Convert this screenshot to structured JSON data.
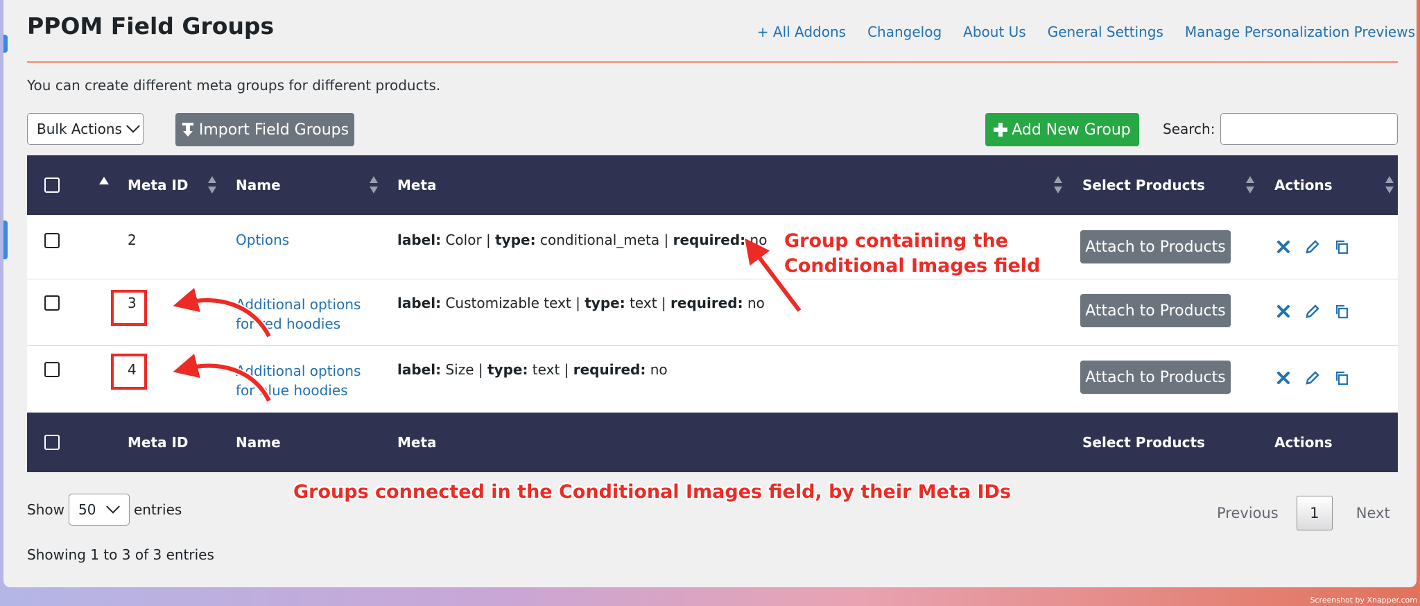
{
  "page": {
    "title": "PPOM Field Groups",
    "description": "You can create different meta groups for different products."
  },
  "topnav": [
    "+ All Addons",
    "Changelog",
    "About Us",
    "General Settings",
    "Manage Personalization Previews"
  ],
  "toolbar": {
    "bulk_actions": "Bulk Actions",
    "import_label": "Import Field Groups",
    "add_new_label": "Add New Group",
    "search_label": "Search:",
    "search_value": ""
  },
  "table": {
    "headers": {
      "meta_id": "Meta ID",
      "name": "Name",
      "meta": "Meta",
      "select_products": "Select Products",
      "actions": "Actions"
    },
    "rows": [
      {
        "id": "2",
        "name_line1": "Options",
        "name_line2": "",
        "meta": [
          [
            "label:",
            " Color | "
          ],
          [
            "type:",
            " conditional_meta | "
          ],
          [
            "required:",
            " no"
          ]
        ],
        "attach": "Attach to Products"
      },
      {
        "id": "3",
        "name_line1": "Additional options",
        "name_line2": "for red hoodies",
        "meta": [
          [
            "label:",
            " Customizable text | "
          ],
          [
            "type:",
            " text | "
          ],
          [
            "required:",
            " no"
          ]
        ],
        "attach": "Attach to Products"
      },
      {
        "id": "4",
        "name_line1": "Additional options",
        "name_line2": "for blue hoodies",
        "meta": [
          [
            "label:",
            " Size | "
          ],
          [
            "type:",
            " text | "
          ],
          [
            "required:",
            " no"
          ]
        ],
        "attach": "Attach to Products"
      }
    ]
  },
  "footer": {
    "show_label": "Show",
    "per_page": "50",
    "entries_label": "entries",
    "info": "Showing 1 to 3 of 3 entries",
    "prev": "Previous",
    "page": "1",
    "next": "Next"
  },
  "annotations": {
    "group_note_line1": "Group containing the",
    "group_note_line2": "Conditional Images field",
    "connected_note": "Groups connected in the Conditional Images field, by their Meta IDs"
  },
  "credit": "Screenshot by Xnapper.com",
  "colors": {
    "header_bg": "#2f3250",
    "link": "#2271b1",
    "annotation": "#ee2a24",
    "add_button": "#28a745",
    "secondary_button": "#6c757d"
  }
}
